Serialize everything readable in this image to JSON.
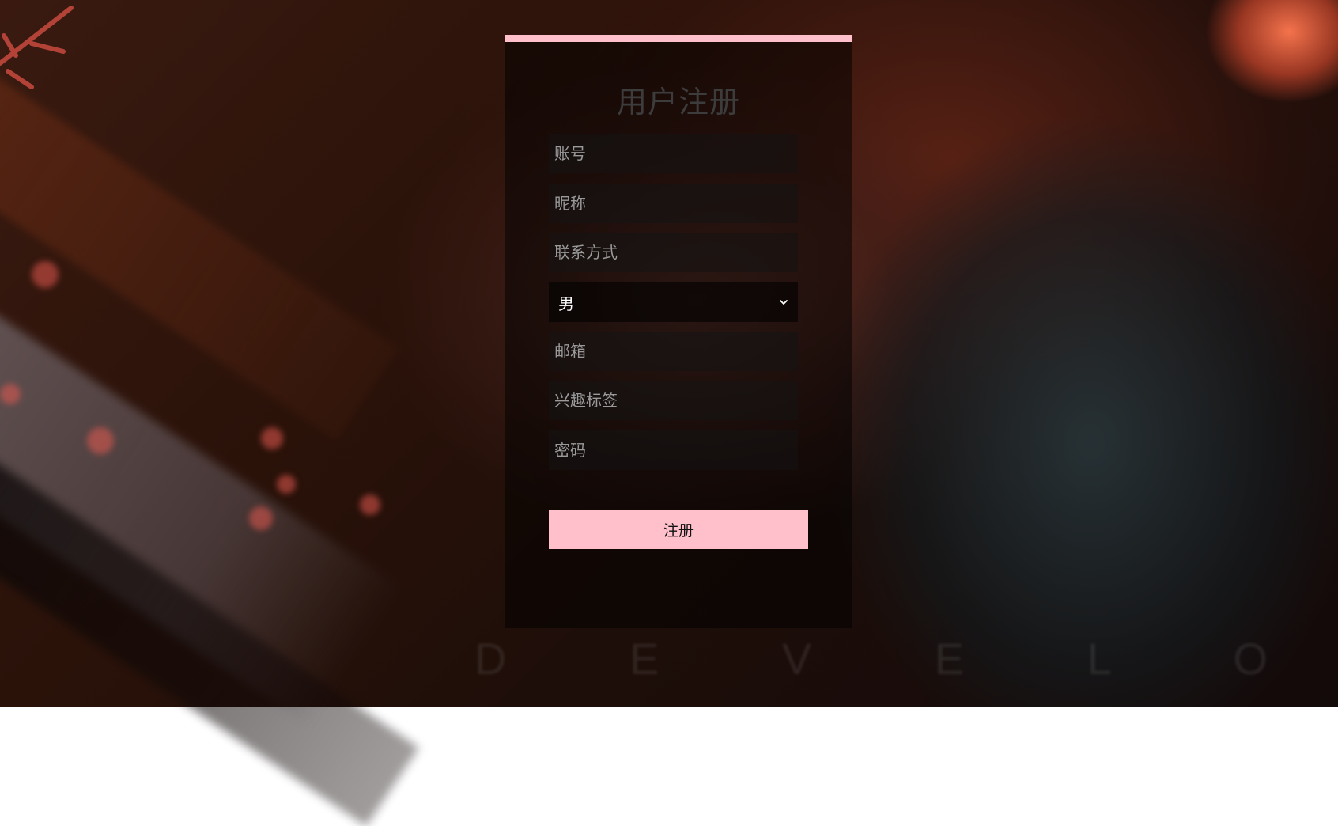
{
  "form": {
    "title": "用户注册",
    "fields": {
      "account": {
        "placeholder": "账号",
        "value": ""
      },
      "nickname": {
        "placeholder": "昵称",
        "value": ""
      },
      "contact": {
        "placeholder": "联系方式",
        "value": ""
      },
      "gender": {
        "selected": "男"
      },
      "email": {
        "placeholder": "邮箱",
        "value": ""
      },
      "interests": {
        "placeholder": "兴趣标签",
        "value": ""
      },
      "password": {
        "placeholder": "密码",
        "value": ""
      }
    },
    "submit_label": "注册"
  },
  "background": {
    "watermark_text": "D E V E L O P"
  },
  "theme": {
    "accent": "#ffc0cb",
    "panel_bg": "rgba(0,0,0,0.5)",
    "title_color": "#3c3c3c",
    "placeholder_color": "#9a9a9a"
  },
  "icons": {
    "gender_dropdown": "chevron-down-icon"
  }
}
